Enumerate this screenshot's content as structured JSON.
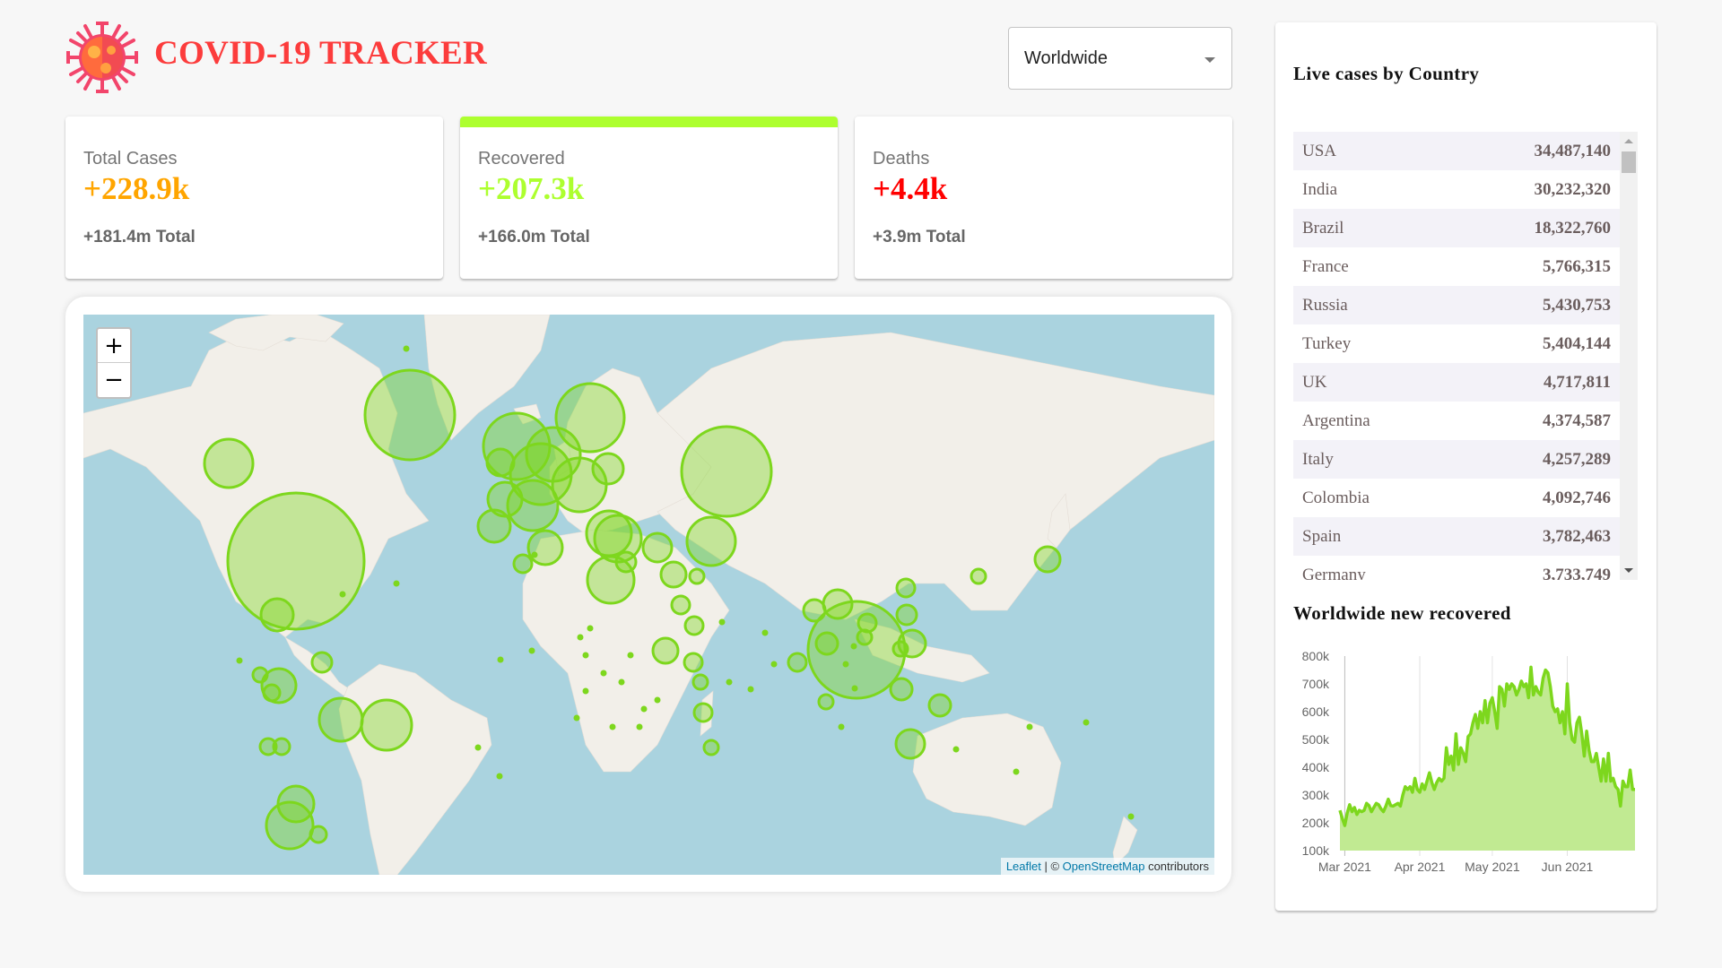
{
  "header": {
    "title": "COVID-19 TRACKER",
    "logo_icon": "virus-icon",
    "country_select": {
      "selected": "Worldwide",
      "icon": "caret-down-icon"
    }
  },
  "info_cards": [
    {
      "label": "Total Cases",
      "today": "+228.9k",
      "total": "+181.4m Total",
      "color": "#ffa500",
      "active": false
    },
    {
      "label": "Recovered",
      "today": "+207.3k",
      "total": "+166.0m Total",
      "color": "#adff2f",
      "active": true
    },
    {
      "label": "Deaths",
      "today": "+4.4k",
      "total": "+3.9m Total",
      "color": "#ff0000",
      "active": false
    }
  ],
  "map": {
    "zoom_in": "+",
    "zoom_out": "−",
    "attribution": {
      "leaflet": "Leaflet",
      "separator": " | © ",
      "osm": "OpenStreetMap",
      "suffix": " contributors"
    },
    "circle_color": "#7dd71d"
  },
  "sidebar": {
    "table_title": "Live cases by Country",
    "countries": [
      {
        "country": "USA",
        "cases": "34,487,140"
      },
      {
        "country": "India",
        "cases": "30,232,320"
      },
      {
        "country": "Brazil",
        "cases": "18,322,760"
      },
      {
        "country": "France",
        "cases": "5,766,315"
      },
      {
        "country": "Russia",
        "cases": "5,430,753"
      },
      {
        "country": "Turkey",
        "cases": "5,404,144"
      },
      {
        "country": "UK",
        "cases": "4,717,811"
      },
      {
        "country": "Argentina",
        "cases": "4,374,587"
      },
      {
        "country": "Italy",
        "cases": "4,257,289"
      },
      {
        "country": "Colombia",
        "cases": "4,092,746"
      },
      {
        "country": "Spain",
        "cases": "3,782,463"
      },
      {
        "country": "Germany",
        "cases": "3,733,749"
      }
    ],
    "chart_title": "Worldwide new recovered"
  },
  "chart_data": {
    "type": "area",
    "title": "Worldwide new recovered",
    "xlabel": "",
    "ylabel": "",
    "x_start": "2021-02-27",
    "x_step_days": 1,
    "x_ticks": [
      "Mar 2021",
      "Apr 2021",
      "May 2021",
      "Jun 2021"
    ],
    "x_tick_days": [
      2,
      33,
      63,
      94
    ],
    "y_ticks": [
      "100k",
      "200k",
      "300k",
      "400k",
      "500k",
      "600k",
      "700k",
      "800k"
    ],
    "ylim": [
      100000,
      800000
    ],
    "grid": "vertical",
    "line_color": "#7dd71d",
    "fill_color": "#c1ea92",
    "values": [
      245000,
      215000,
      190000,
      235000,
      265000,
      240000,
      255000,
      230000,
      245000,
      240000,
      245000,
      270000,
      262000,
      240000,
      255000,
      270000,
      265000,
      250000,
      240000,
      260000,
      285000,
      262000,
      260000,
      265000,
      270000,
      260000,
      300000,
      330000,
      320000,
      330000,
      310000,
      360000,
      320000,
      310000,
      340000,
      320000,
      350000,
      380000,
      345000,
      320000,
      345000,
      360000,
      350000,
      360000,
      470000,
      410000,
      440000,
      390000,
      520000,
      410000,
      470000,
      450000,
      420000,
      510000,
      520000,
      560000,
      590000,
      540000,
      600000,
      560000,
      640000,
      560000,
      630000,
      650000,
      600000,
      540000,
      690000,
      680000,
      620000,
      700000,
      680000,
      700000,
      690000,
      660000,
      680000,
      710000,
      690000,
      700000,
      650000,
      760000,
      660000,
      690000,
      670000,
      660000,
      720000,
      750000,
      740000,
      690000,
      620000,
      600000,
      610000,
      560000,
      600000,
      520000,
      700000,
      560000,
      500000,
      490000,
      560000,
      580000,
      520000,
      440000,
      530000,
      460000,
      420000,
      420000,
      450000,
      400000,
      350000,
      430000,
      350000,
      450000,
      350000,
      360000,
      330000,
      320000,
      260000,
      350000,
      330000,
      330000,
      390000,
      320000,
      320000
    ],
    "series": [
      {
        "name": "Worldwide new recovered"
      }
    ]
  }
}
